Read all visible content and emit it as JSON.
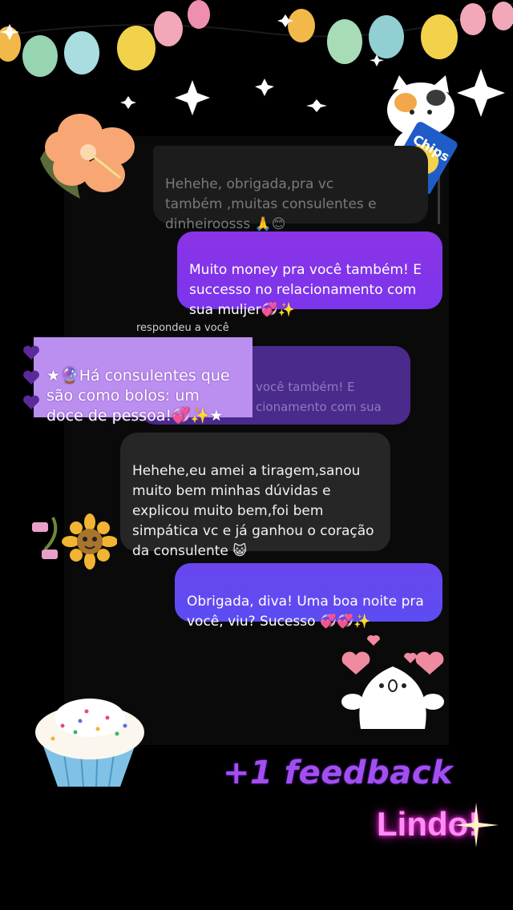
{
  "messages": [
    {
      "id": "m1",
      "side": "in",
      "text": "Hehehe, obrigada,pra vc\ntambém ,muitas consulentes e\ndinheiroosss 🙏😊",
      "faded": true
    },
    {
      "id": "m2",
      "side": "out",
      "text": "Muito money pra você também! E\nsuccesso no relacionamento com\nsua muljer💞✨"
    },
    {
      "id": "m3",
      "side": "in",
      "text": "Hehehe,eu amei a tiragem,sanou\nmuito bem minhas dúvidas e\nexplicou muito bem,foi bem\nsimpática vc e já ganhou o coração\nda consulente 😺"
    },
    {
      "id": "m4",
      "side": "out",
      "text": "Obrigada, diva! Uma boa noite pra\nvocê, viu? Sucesso 💞💞✨"
    }
  ],
  "reply": {
    "label": "respondeu a você",
    "quoted_text": "você também! E\ncionamento com sua"
  },
  "sticker_note": "★🔮Há consulentes que\nsão como bolos: um\ndoce de pessoa!💞✨★",
  "overlay": {
    "feedback": "+1 feedback",
    "lindo": "Lindo!",
    "chips_label": "Chips"
  },
  "colors": {
    "background": "#000000",
    "incoming_bubble": "#262626",
    "outgoing_bubble": "#8b34e6",
    "outgoing_bubble_2": "#5b4cf2",
    "sticker_note": "#bb8ff0",
    "feedback_text": "#a24ff2",
    "lindo_glow": "#ff2ee4"
  },
  "icons": [
    "balloon-garland",
    "sparkle-stars",
    "hibiscus-flower-sticker",
    "cat-with-chips-sticker",
    "sunflower-sticker",
    "roller-skate-sticker",
    "cupcake-sticker",
    "bunny-hearts-sticker",
    "purple-heart-icon",
    "sparkle-icon"
  ]
}
